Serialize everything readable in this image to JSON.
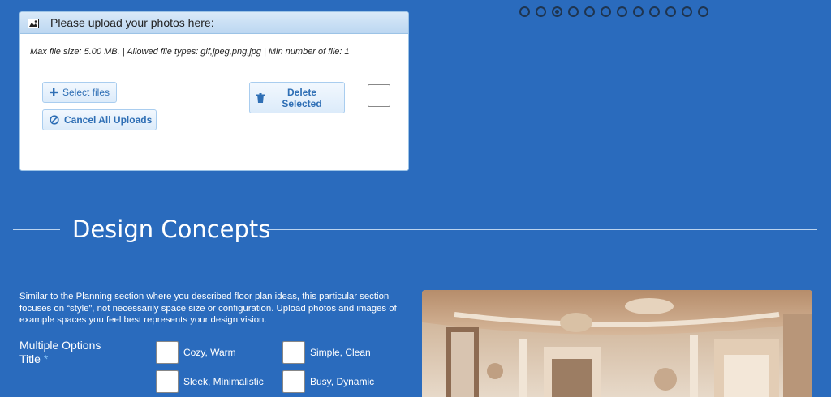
{
  "upload": {
    "header": "Please upload your photos here:",
    "header_icon": "image-icon",
    "info": "Max file size: 5.00 MB. | Allowed file types: gif,jpeg,png,jpg | Min number of file: 1",
    "select_files_label": "Select files",
    "cancel_all_label": "Cancel All Uploads",
    "delete_selected_label": "Delete Selected",
    "accent_color": "#2f6fb5"
  },
  "pagination": {
    "count": 12,
    "active_index": 2
  },
  "section": {
    "title": "Design Concepts",
    "intro": "Similar to the Planning section where you described floor plan ideas, this particular section focuses on “style”, not necessarily space size or configuration. Upload photos and images of example spaces you feel best represents your design vision.",
    "options_title": "Multiple Options Title",
    "required_mark": "*",
    "options": [
      {
        "label": "Cozy, Warm"
      },
      {
        "label": "Simple, Clean"
      },
      {
        "label": "Sleek, Minimalistic"
      },
      {
        "label": "Busy, Dynamic"
      }
    ]
  },
  "theme": {
    "background": "#2a6bbd",
    "text": "#ffffff"
  }
}
